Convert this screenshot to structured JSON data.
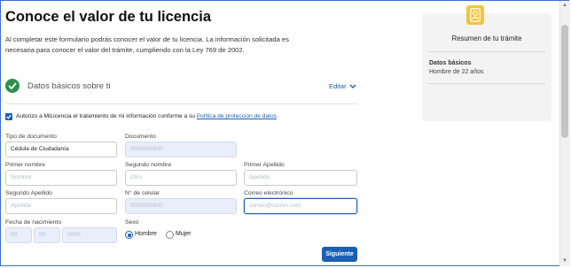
{
  "page": {
    "title": "Conoce el valor de tu licencia",
    "intro_line1": "Al completar este formulario podrás conocer el valor de tu licencia. La información solicitada es",
    "intro_line2": "necesaria para conocer el valor del trámite, cumpliendo con la Ley 769 de 2002."
  },
  "section": {
    "title": "Datos básicos sobre ti",
    "edit_label": "Editar",
    "status_icon": "check-circle-icon",
    "accent": "#2f8f4e"
  },
  "consent": {
    "checked": true,
    "text": "Autorizo a MiLicencia el tratamiento de mi información conforme a su ",
    "link": "Política de protección de datos"
  },
  "form": {
    "doc_type": {
      "label": "Tipo de documento",
      "value": "Cédula de Ciudadanía"
    },
    "document": {
      "label": "Documento",
      "value": "0000000000"
    },
    "first_name": {
      "label": "Primer nombre",
      "value": "Nombre"
    },
    "second_name": {
      "label": "Segundo nombre",
      "value": "Otro"
    },
    "first_surname": {
      "label": "Primer Apellido",
      "value": "Apellido"
    },
    "second_surname": {
      "label": "Segundo Apellido",
      "value": "Apellido"
    },
    "phone": {
      "label": "N° de celular",
      "value": "3000000000"
    },
    "email": {
      "label": "Correo electrónico",
      "value": "correo@correo.com"
    },
    "birth": {
      "label": "Fecha de nacimiento",
      "day": "00",
      "month": "00",
      "year": "0000"
    },
    "sex": {
      "label": "Sexo",
      "options": [
        "Hombre",
        "Mujer"
      ],
      "selected": "Hombre"
    }
  },
  "actions": {
    "next_label": "Siguiente",
    "primary_color": "#1a5fb4"
  },
  "summary": {
    "icon": "id-badge-icon",
    "title": "Resumen de tu trámite",
    "item_label": "Datos básicos",
    "item_value": "Hombre de 22 años"
  }
}
